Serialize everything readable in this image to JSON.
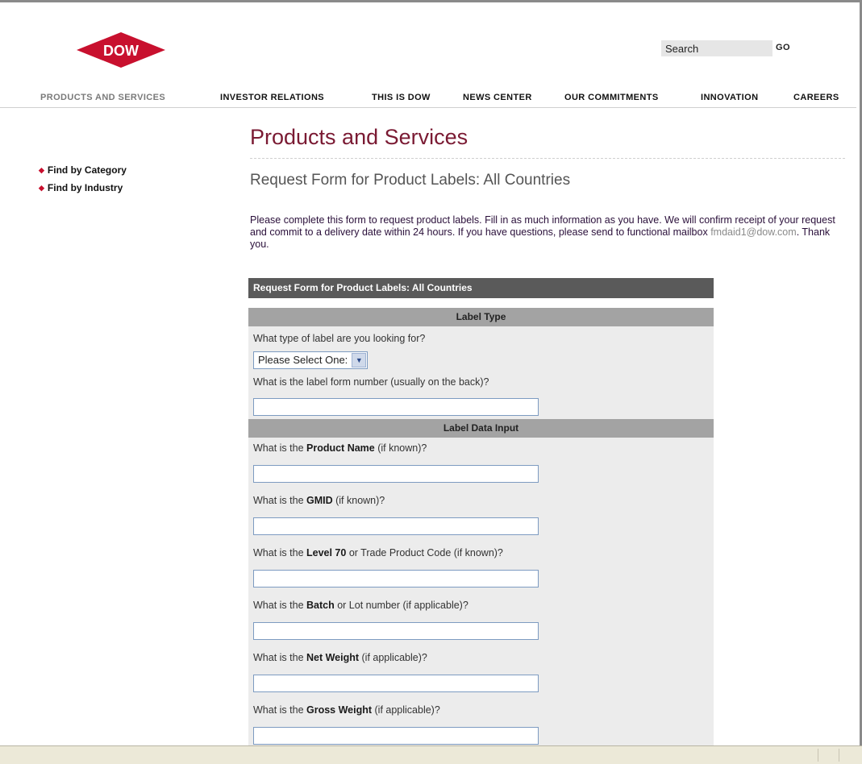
{
  "header": {
    "logo_text": "DOW",
    "search_placeholder": "Search",
    "go_label": "GO"
  },
  "nav": {
    "items": [
      {
        "label": "PRODUCTS AND SERVICES",
        "active": true
      },
      {
        "label": "INVESTOR RELATIONS",
        "active": false
      },
      {
        "label": "THIS IS DOW",
        "active": false
      },
      {
        "label": "NEWS CENTER",
        "active": false
      },
      {
        "label": "OUR COMMITMENTS",
        "active": false
      },
      {
        "label": "INNOVATION",
        "active": false
      },
      {
        "label": "CAREERS",
        "active": false
      }
    ]
  },
  "sidebar": {
    "items": [
      {
        "label": "Find by Category"
      },
      {
        "label": "Find by Industry"
      }
    ]
  },
  "main": {
    "title": "Products and Services",
    "subtitle": "Request Form for Product Labels: All Countries",
    "intro_text": "Please complete this form to request product labels. Fill in as much information as you have. We will confirm receipt of your request and commit to a delivery date within 24 hours. If you have questions, please send to functional mailbox",
    "intro_email": "fmdaid1@dow.com",
    "intro_end": ". Thank you."
  },
  "form": {
    "header": "Request Form for Product Labels: All Countries",
    "section_label_type": "Label Type",
    "q_label_type": "What type of label are you looking for?",
    "label_type_select_value": "Please Select One:",
    "q_form_number": "What is the label form number (usually on the back)?",
    "section_label_data": "Label Data Input",
    "q_product_name": {
      "pre": "What is the ",
      "bold": "Product Name",
      "post": " (if known)?"
    },
    "q_gmid": {
      "pre": "What is the ",
      "bold": "GMID",
      "post": " (if known)?"
    },
    "q_level70": {
      "pre": "What is the ",
      "bold": "Level 70",
      "post": " or Trade Product Code (if known)?"
    },
    "q_batch": {
      "pre": "What is the ",
      "bold": "Batch",
      "post": " or Lot number (if applicable)?"
    },
    "q_net_weight": {
      "pre": "What is the ",
      "bold": "Net Weight",
      "post": " (if applicable)?"
    },
    "q_gross_weight": {
      "pre": "What is the ",
      "bold": "Gross Weight",
      "post": " (if applicable)?"
    }
  },
  "colors": {
    "brand_red": "#c8102e",
    "title_maroon": "#7a1a33",
    "form_header_bg": "#5a5a5a",
    "section_bar_bg": "#a3a3a3"
  }
}
